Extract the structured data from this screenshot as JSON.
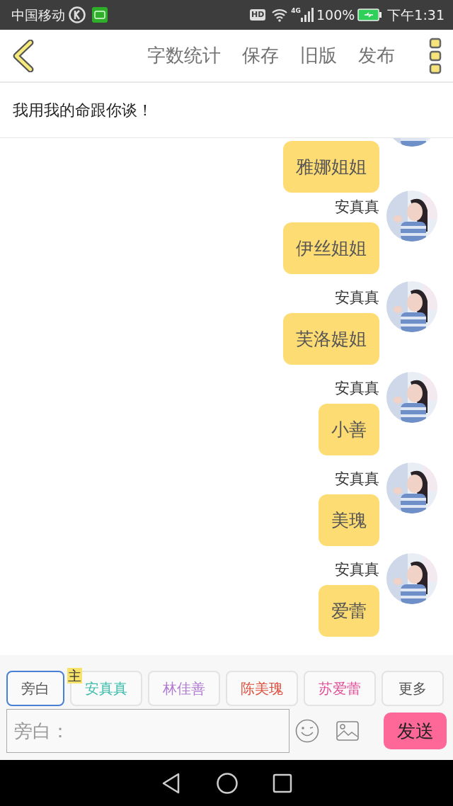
{
  "status_bar": {
    "carrier": "中国移动",
    "hd_badge": "HD",
    "network": "4G",
    "battery": "100%",
    "time": "下午1:31"
  },
  "toolbar": {
    "actions": [
      "字数统计",
      "保存",
      "旧版",
      "发布"
    ]
  },
  "title": "我用我的命跟你谈！",
  "messages": [
    {
      "text": "雅娜姐姐"
    },
    {
      "name": "安真真",
      "text": "伊丝姐姐"
    },
    {
      "name": "安真真",
      "text": "芙洛媞姐"
    },
    {
      "name": "安真真",
      "text": "小善"
    },
    {
      "name": "安真真",
      "text": "美瑰"
    },
    {
      "name": "安真真",
      "text": "爱蕾"
    }
  ],
  "roles": [
    {
      "label": "旁白",
      "selected": true,
      "color": "#555555"
    },
    {
      "label": "安真真",
      "selected": false,
      "color": "#3dbdab",
      "badge": "主"
    },
    {
      "label": "林佳善",
      "selected": false,
      "color": "#b07ad0"
    },
    {
      "label": "陈美瑰",
      "selected": false,
      "color": "#dd4f3c"
    },
    {
      "label": "苏爱蕾",
      "selected": false,
      "color": "#e0539a"
    },
    {
      "label": "更多",
      "selected": false,
      "color": "#555555"
    }
  ],
  "input": {
    "placeholder": "旁白："
  },
  "send_button": "发送"
}
